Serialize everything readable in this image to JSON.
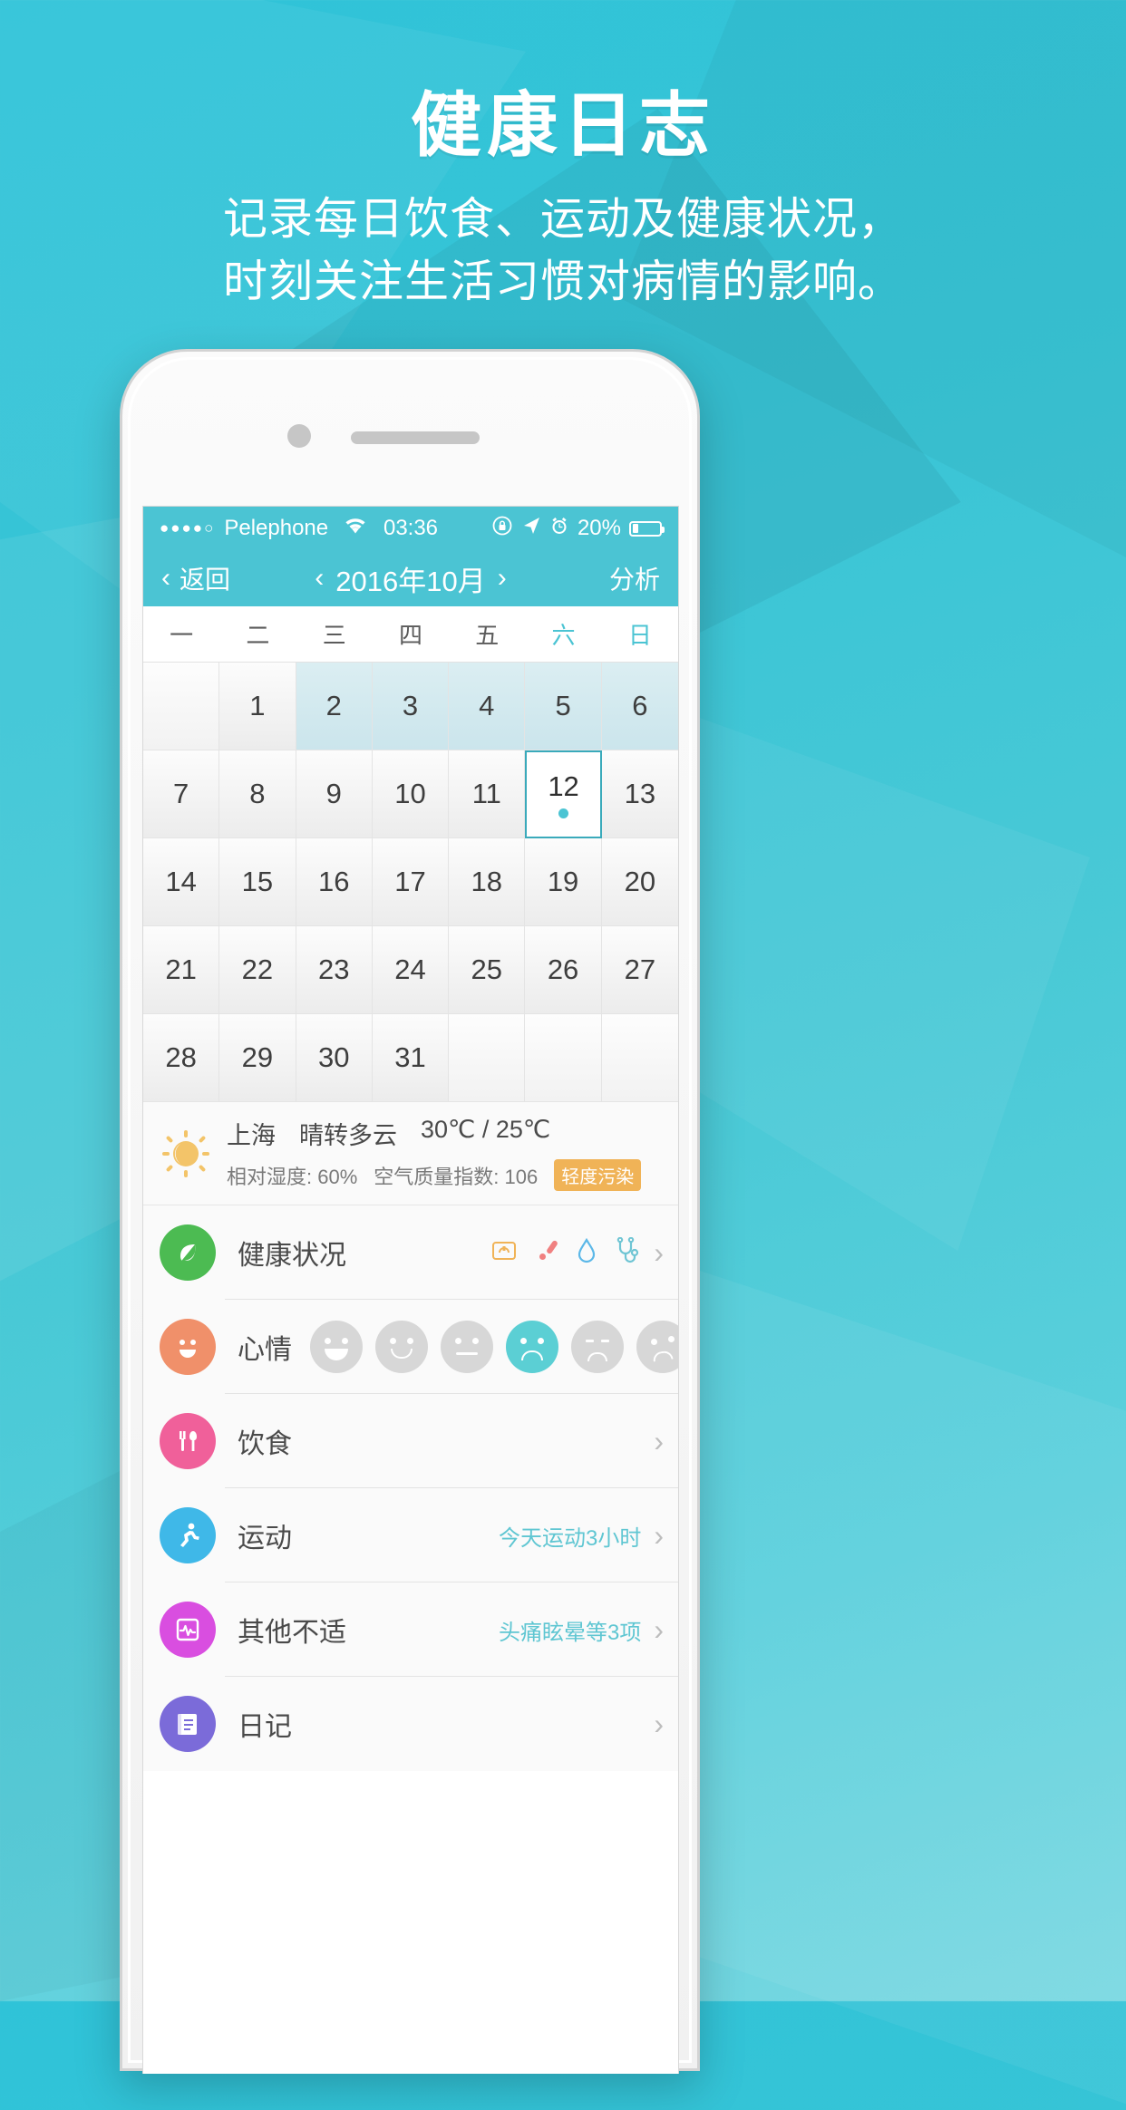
{
  "promo": {
    "headline": "健康日志",
    "subtitle_line1": "记录每日饮食、运动及健康状况，",
    "subtitle_line2": "时刻关注生活习惯对病情的影响。"
  },
  "statusbar": {
    "signal_dots": "●●●●○",
    "carrier": "Pelephone",
    "wifi_icon": "wifi-icon",
    "time": "03:36",
    "rotation_lock_icon": "rotation-lock-icon",
    "location_icon": "location-arrow-icon",
    "alarm_icon": "alarm-clock-icon",
    "battery_percent": "20%",
    "battery_icon": "battery-icon"
  },
  "navbar": {
    "back_label": "返回",
    "back_chevron": "‹",
    "title": "2016年10月",
    "prev_chevron": "‹",
    "next_chevron": "›",
    "right_action": "分析"
  },
  "calendar": {
    "weekdays": [
      {
        "label": "一",
        "weekend": false
      },
      {
        "label": "二",
        "weekend": false
      },
      {
        "label": "三",
        "weekend": false
      },
      {
        "label": "四",
        "weekend": false
      },
      {
        "label": "五",
        "weekend": false
      },
      {
        "label": "六",
        "weekend": true
      },
      {
        "label": "日",
        "weekend": true
      }
    ],
    "days": [
      {
        "label": "",
        "state": "empty"
      },
      {
        "label": "1",
        "state": "normal"
      },
      {
        "label": "2",
        "state": "shaded"
      },
      {
        "label": "3",
        "state": "shaded"
      },
      {
        "label": "4",
        "state": "shaded"
      },
      {
        "label": "5",
        "state": "shaded"
      },
      {
        "label": "6",
        "state": "shaded"
      },
      {
        "label": "7",
        "state": "normal"
      },
      {
        "label": "8",
        "state": "normal"
      },
      {
        "label": "9",
        "state": "normal"
      },
      {
        "label": "10",
        "state": "normal"
      },
      {
        "label": "11",
        "state": "normal"
      },
      {
        "label": "12",
        "state": "today"
      },
      {
        "label": "13",
        "state": "normal"
      },
      {
        "label": "14",
        "state": "normal"
      },
      {
        "label": "15",
        "state": "normal"
      },
      {
        "label": "16",
        "state": "normal"
      },
      {
        "label": "17",
        "state": "normal"
      },
      {
        "label": "18",
        "state": "normal"
      },
      {
        "label": "19",
        "state": "normal"
      },
      {
        "label": "20",
        "state": "normal"
      },
      {
        "label": "21",
        "state": "normal"
      },
      {
        "label": "22",
        "state": "normal"
      },
      {
        "label": "23",
        "state": "normal"
      },
      {
        "label": "24",
        "state": "normal"
      },
      {
        "label": "25",
        "state": "normal"
      },
      {
        "label": "26",
        "state": "normal"
      },
      {
        "label": "27",
        "state": "normal"
      },
      {
        "label": "28",
        "state": "normal"
      },
      {
        "label": "29",
        "state": "normal"
      },
      {
        "label": "30",
        "state": "normal"
      },
      {
        "label": "31",
        "state": "normal"
      },
      {
        "label": "",
        "state": "empty"
      },
      {
        "label": "",
        "state": "empty"
      },
      {
        "label": "",
        "state": "empty"
      }
    ]
  },
  "weather": {
    "icon": "sun-cloud-icon",
    "city": "上海",
    "condition": "晴转多云",
    "temperature": "30℃ / 25℃",
    "humidity": "相对湿度: 60%",
    "aqi": "空气质量指数: 106",
    "aqi_badge": "轻度污染",
    "badge_color": "#f0b357"
  },
  "list": {
    "rows": [
      {
        "name": "health-status",
        "label": "健康状况",
        "icon": "leaf-icon",
        "icon_color": "#4cbb52",
        "value": "",
        "mini_icons": [
          "scale-icon",
          "thermometer-icon",
          "blood-drop-icon",
          "stethoscope-icon"
        ],
        "arrow": "›"
      },
      {
        "name": "mood",
        "label": "心情",
        "icon": "smiley-icon",
        "icon_color": "#f0906a",
        "value": "",
        "moods": [
          "happy",
          "smile",
          "neutral",
          "sad",
          "cry",
          "upset"
        ],
        "selected_mood_index": 3,
        "arrow": ""
      },
      {
        "name": "diet",
        "label": "饮食",
        "icon": "cutlery-icon",
        "icon_color": "#f0609a",
        "value": "",
        "arrow": "›"
      },
      {
        "name": "exercise",
        "label": "运动",
        "icon": "running-icon",
        "icon_color": "#3fb8e8",
        "value": "今天运动3小时",
        "arrow": "›"
      },
      {
        "name": "other-discomfort",
        "label": "其他不适",
        "icon": "pulse-icon",
        "icon_color": "#d94ee0",
        "value": "头痛眩晕等3项",
        "arrow": "›"
      },
      {
        "name": "diary",
        "label": "日记",
        "icon": "notebook-icon",
        "icon_color": "#7b6bd9",
        "value": "",
        "arrow": "›"
      }
    ]
  },
  "theme": {
    "accent": "#4bc4d3",
    "bg_top": "#2fc3d8",
    "bg_bottom": "#7ad8e2"
  }
}
